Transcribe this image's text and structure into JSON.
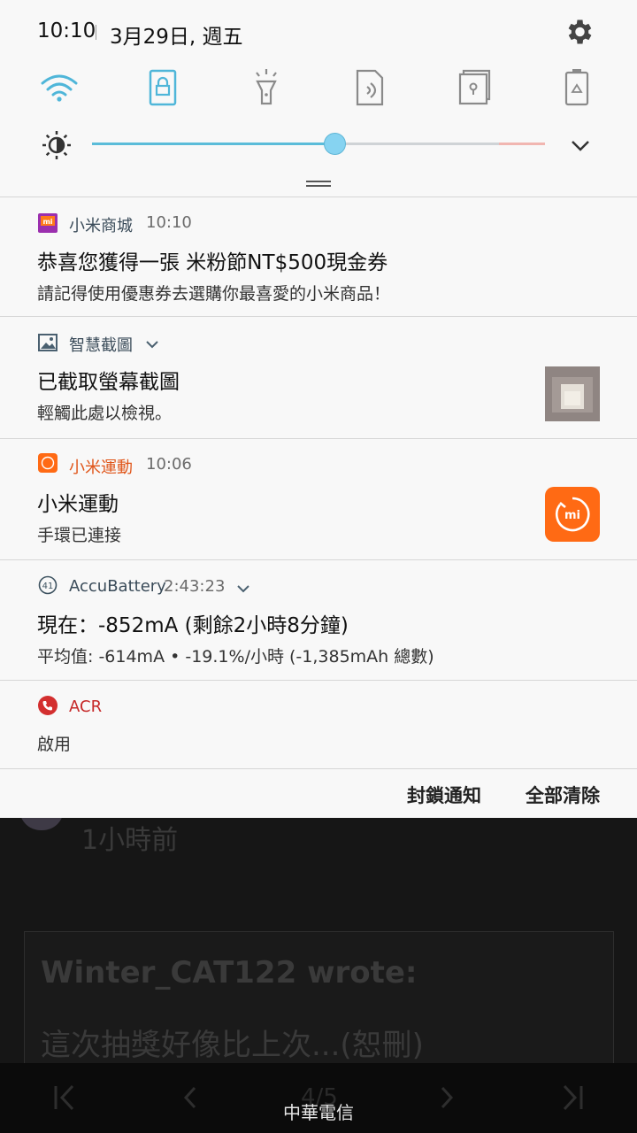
{
  "status_bar": {
    "time": "10:10",
    "date": "3月29日, 週五"
  },
  "quick_settings": [
    {
      "name": "wifi",
      "active": true
    },
    {
      "name": "screen-lock-rotation",
      "active": true
    },
    {
      "name": "flashlight",
      "active": false
    },
    {
      "name": "nfc",
      "active": false
    },
    {
      "name": "secure-folder",
      "active": false
    },
    {
      "name": "power-saving",
      "active": false
    }
  ],
  "brightness": {
    "level": 0.53
  },
  "colors": {
    "accent": "#4fb6d9",
    "xiaomi_orange": "#ff6a14",
    "acr_red": "#d32f2f"
  },
  "notifications": [
    {
      "app": "小米商城",
      "time": "10:10",
      "icon": "mi-store-icon",
      "title": "恭喜您獲得一張 米粉節NT$500現金券",
      "body": "請記得使用優惠券去選購你最喜愛的小米商品！"
    },
    {
      "app": "智慧截圖",
      "icon": "image-icon",
      "title": "已截取螢幕截圖",
      "body": "輕觸此處以檢視。"
    },
    {
      "app": "小米運動",
      "time": "10:06",
      "icon": "mi-fit-icon",
      "title": "小米運動",
      "body": "手環已連接"
    },
    {
      "app": "AccuBattery",
      "time": "2:43:23",
      "icon_text": "41",
      "title": "現在：-852mA (剩餘2小時8分鐘)",
      "body": "平均值: -614mA • -19.1%/小時 (-1,385mAh 總數)"
    },
    {
      "app": "ACR",
      "icon": "phone-icon",
      "body": "啟用"
    }
  ],
  "actions": {
    "block": "封鎖通知",
    "clear_all": "全部清除"
  },
  "background_app": {
    "post_time": "1小時前",
    "quote_author": "Winter_CAT122 wrote:",
    "quote_text": "這次抽獎好像比上次...(恕刪)",
    "page_indicator": "4/5"
  },
  "carrier": "中華電信"
}
